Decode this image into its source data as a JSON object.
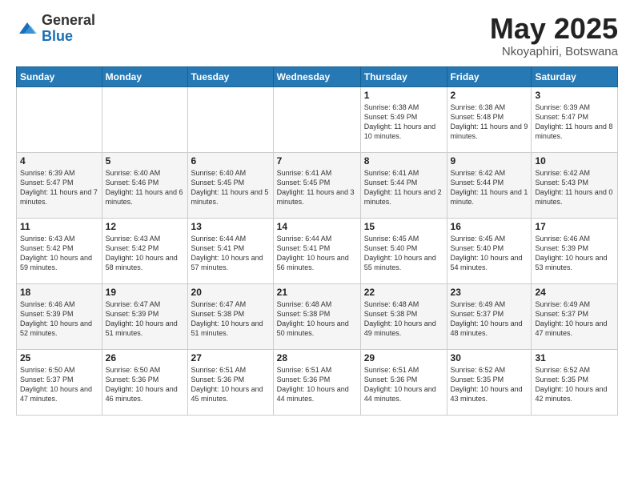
{
  "header": {
    "logo_general": "General",
    "logo_blue": "Blue",
    "month_title": "May 2025",
    "location": "Nkoyaphiri, Botswana"
  },
  "weekdays": [
    "Sunday",
    "Monday",
    "Tuesday",
    "Wednesday",
    "Thursday",
    "Friday",
    "Saturday"
  ],
  "weeks": [
    [
      {
        "day": "",
        "info": ""
      },
      {
        "day": "",
        "info": ""
      },
      {
        "day": "",
        "info": ""
      },
      {
        "day": "",
        "info": ""
      },
      {
        "day": "1",
        "info": "Sunrise: 6:38 AM\nSunset: 5:49 PM\nDaylight: 11 hours and 10 minutes."
      },
      {
        "day": "2",
        "info": "Sunrise: 6:38 AM\nSunset: 5:48 PM\nDaylight: 11 hours and 9 minutes."
      },
      {
        "day": "3",
        "info": "Sunrise: 6:39 AM\nSunset: 5:47 PM\nDaylight: 11 hours and 8 minutes."
      }
    ],
    [
      {
        "day": "4",
        "info": "Sunrise: 6:39 AM\nSunset: 5:47 PM\nDaylight: 11 hours and 7 minutes."
      },
      {
        "day": "5",
        "info": "Sunrise: 6:40 AM\nSunset: 5:46 PM\nDaylight: 11 hours and 6 minutes."
      },
      {
        "day": "6",
        "info": "Sunrise: 6:40 AM\nSunset: 5:45 PM\nDaylight: 11 hours and 5 minutes."
      },
      {
        "day": "7",
        "info": "Sunrise: 6:41 AM\nSunset: 5:45 PM\nDaylight: 11 hours and 3 minutes."
      },
      {
        "day": "8",
        "info": "Sunrise: 6:41 AM\nSunset: 5:44 PM\nDaylight: 11 hours and 2 minutes."
      },
      {
        "day": "9",
        "info": "Sunrise: 6:42 AM\nSunset: 5:44 PM\nDaylight: 11 hours and 1 minute."
      },
      {
        "day": "10",
        "info": "Sunrise: 6:42 AM\nSunset: 5:43 PM\nDaylight: 11 hours and 0 minutes."
      }
    ],
    [
      {
        "day": "11",
        "info": "Sunrise: 6:43 AM\nSunset: 5:42 PM\nDaylight: 10 hours and 59 minutes."
      },
      {
        "day": "12",
        "info": "Sunrise: 6:43 AM\nSunset: 5:42 PM\nDaylight: 10 hours and 58 minutes."
      },
      {
        "day": "13",
        "info": "Sunrise: 6:44 AM\nSunset: 5:41 PM\nDaylight: 10 hours and 57 minutes."
      },
      {
        "day": "14",
        "info": "Sunrise: 6:44 AM\nSunset: 5:41 PM\nDaylight: 10 hours and 56 minutes."
      },
      {
        "day": "15",
        "info": "Sunrise: 6:45 AM\nSunset: 5:40 PM\nDaylight: 10 hours and 55 minutes."
      },
      {
        "day": "16",
        "info": "Sunrise: 6:45 AM\nSunset: 5:40 PM\nDaylight: 10 hours and 54 minutes."
      },
      {
        "day": "17",
        "info": "Sunrise: 6:46 AM\nSunset: 5:39 PM\nDaylight: 10 hours and 53 minutes."
      }
    ],
    [
      {
        "day": "18",
        "info": "Sunrise: 6:46 AM\nSunset: 5:39 PM\nDaylight: 10 hours and 52 minutes."
      },
      {
        "day": "19",
        "info": "Sunrise: 6:47 AM\nSunset: 5:39 PM\nDaylight: 10 hours and 51 minutes."
      },
      {
        "day": "20",
        "info": "Sunrise: 6:47 AM\nSunset: 5:38 PM\nDaylight: 10 hours and 51 minutes."
      },
      {
        "day": "21",
        "info": "Sunrise: 6:48 AM\nSunset: 5:38 PM\nDaylight: 10 hours and 50 minutes."
      },
      {
        "day": "22",
        "info": "Sunrise: 6:48 AM\nSunset: 5:38 PM\nDaylight: 10 hours and 49 minutes."
      },
      {
        "day": "23",
        "info": "Sunrise: 6:49 AM\nSunset: 5:37 PM\nDaylight: 10 hours and 48 minutes."
      },
      {
        "day": "24",
        "info": "Sunrise: 6:49 AM\nSunset: 5:37 PM\nDaylight: 10 hours and 47 minutes."
      }
    ],
    [
      {
        "day": "25",
        "info": "Sunrise: 6:50 AM\nSunset: 5:37 PM\nDaylight: 10 hours and 47 minutes."
      },
      {
        "day": "26",
        "info": "Sunrise: 6:50 AM\nSunset: 5:36 PM\nDaylight: 10 hours and 46 minutes."
      },
      {
        "day": "27",
        "info": "Sunrise: 6:51 AM\nSunset: 5:36 PM\nDaylight: 10 hours and 45 minutes."
      },
      {
        "day": "28",
        "info": "Sunrise: 6:51 AM\nSunset: 5:36 PM\nDaylight: 10 hours and 44 minutes."
      },
      {
        "day": "29",
        "info": "Sunrise: 6:51 AM\nSunset: 5:36 PM\nDaylight: 10 hours and 44 minutes."
      },
      {
        "day": "30",
        "info": "Sunrise: 6:52 AM\nSunset: 5:35 PM\nDaylight: 10 hours and 43 minutes."
      },
      {
        "day": "31",
        "info": "Sunrise: 6:52 AM\nSunset: 5:35 PM\nDaylight: 10 hours and 42 minutes."
      }
    ]
  ]
}
